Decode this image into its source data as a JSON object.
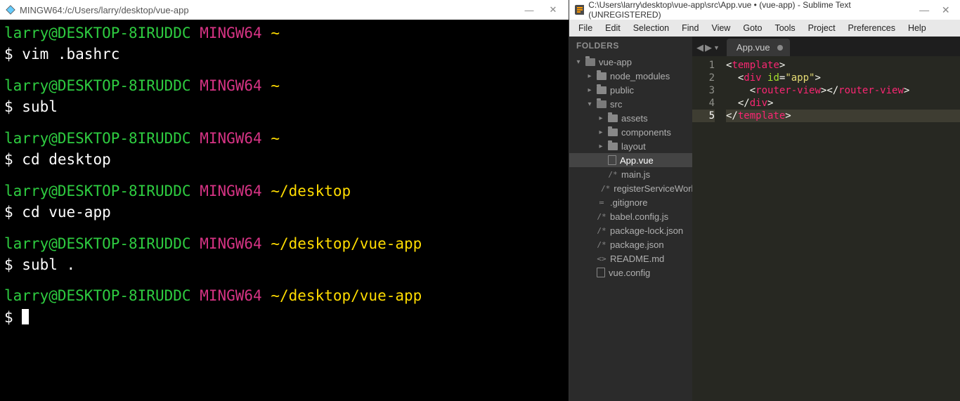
{
  "terminal": {
    "title": "MINGW64:/c/Users/larry/desktop/vue-app",
    "user": "larry",
    "host": "DESKTOP-8IRUDDC",
    "mingw": "MINGW64",
    "blocks": [
      {
        "path": "~",
        "cmd": "vim .bashrc"
      },
      {
        "path": "~",
        "cmd": "subl"
      },
      {
        "path": "~",
        "cmd": "cd desktop"
      },
      {
        "path": "~/desktop",
        "cmd": "cd vue-app"
      },
      {
        "path": "~/desktop/vue-app",
        "cmd": "subl ."
      },
      {
        "path": "~/desktop/vue-app",
        "cmd": ""
      }
    ],
    "winbuttons": {
      "min": "—",
      "close": "✕"
    }
  },
  "sublime": {
    "title": "C:\\Users\\larry\\desktop\\vue-app\\src\\App.vue • (vue-app) - Sublime Text (UNREGISTERED)",
    "menus": [
      "File",
      "Edit",
      "Selection",
      "Find",
      "View",
      "Goto",
      "Tools",
      "Project",
      "Preferences",
      "Help"
    ],
    "sidebar": {
      "header": "FOLDERS",
      "tree": [
        {
          "depth": 0,
          "twisty": "▾",
          "icon": "folder-open",
          "label": "vue-app"
        },
        {
          "depth": 1,
          "twisty": "▸",
          "icon": "folder",
          "label": "node_modules"
        },
        {
          "depth": 1,
          "twisty": "▸",
          "icon": "folder",
          "label": "public"
        },
        {
          "depth": 1,
          "twisty": "▾",
          "icon": "folder-open",
          "label": "src"
        },
        {
          "depth": 2,
          "twisty": "▸",
          "icon": "folder",
          "label": "assets"
        },
        {
          "depth": 2,
          "twisty": "▸",
          "icon": "folder",
          "label": "components"
        },
        {
          "depth": 2,
          "twisty": "▸",
          "icon": "folder",
          "label": "layout"
        },
        {
          "depth": 2,
          "twisty": "",
          "icon": "file",
          "label": "App.vue",
          "selected": true
        },
        {
          "depth": 2,
          "twisty": "",
          "icon": "js",
          "label": "main.js"
        },
        {
          "depth": 2,
          "twisty": "",
          "icon": "js",
          "label": "registerServiceWork"
        },
        {
          "depth": 1,
          "twisty": "",
          "icon": "gitignore",
          "label": ".gitignore"
        },
        {
          "depth": 1,
          "twisty": "",
          "icon": "js",
          "label": "babel.config.js"
        },
        {
          "depth": 1,
          "twisty": "",
          "icon": "js",
          "label": "package-lock.json"
        },
        {
          "depth": 1,
          "twisty": "",
          "icon": "js",
          "label": "package.json"
        },
        {
          "depth": 1,
          "twisty": "",
          "icon": "md",
          "label": "README.md"
        },
        {
          "depth": 1,
          "twisty": "",
          "icon": "file",
          "label": "vue.config"
        }
      ]
    },
    "tab": {
      "label": "App.vue"
    },
    "tabnav": {
      "prev": "◀",
      "next": "▶",
      "menu": "▼"
    },
    "code": {
      "lines": [
        "1",
        "2",
        "3",
        "4",
        "5"
      ],
      "current": 5,
      "tokens": [
        [
          {
            "t": "br",
            "v": "<"
          },
          {
            "t": "tag",
            "v": "template"
          },
          {
            "t": "br",
            "v": ">"
          }
        ],
        [
          {
            "t": "sp",
            "v": "  "
          },
          {
            "t": "br",
            "v": "<"
          },
          {
            "t": "tag",
            "v": "div"
          },
          {
            "t": "sp",
            "v": " "
          },
          {
            "t": "attr",
            "v": "id"
          },
          {
            "t": "br",
            "v": "="
          },
          {
            "t": "str",
            "v": "\"app\""
          },
          {
            "t": "br",
            "v": ">"
          }
        ],
        [
          {
            "t": "sp",
            "v": "    "
          },
          {
            "t": "br",
            "v": "<"
          },
          {
            "t": "tag",
            "v": "router-view"
          },
          {
            "t": "br",
            "v": ">"
          },
          {
            "t": "br",
            "v": "</"
          },
          {
            "t": "tag",
            "v": "router-view"
          },
          {
            "t": "br",
            "v": ">"
          }
        ],
        [
          {
            "t": "sp",
            "v": "  "
          },
          {
            "t": "br",
            "v": "</"
          },
          {
            "t": "tag",
            "v": "div"
          },
          {
            "t": "br",
            "v": ">"
          }
        ],
        [
          {
            "t": "br",
            "v": "</"
          },
          {
            "t": "tag",
            "v": "template"
          },
          {
            "t": "br",
            "v": ">"
          }
        ]
      ]
    },
    "winbuttons": {
      "min": "—",
      "close": "✕"
    }
  }
}
